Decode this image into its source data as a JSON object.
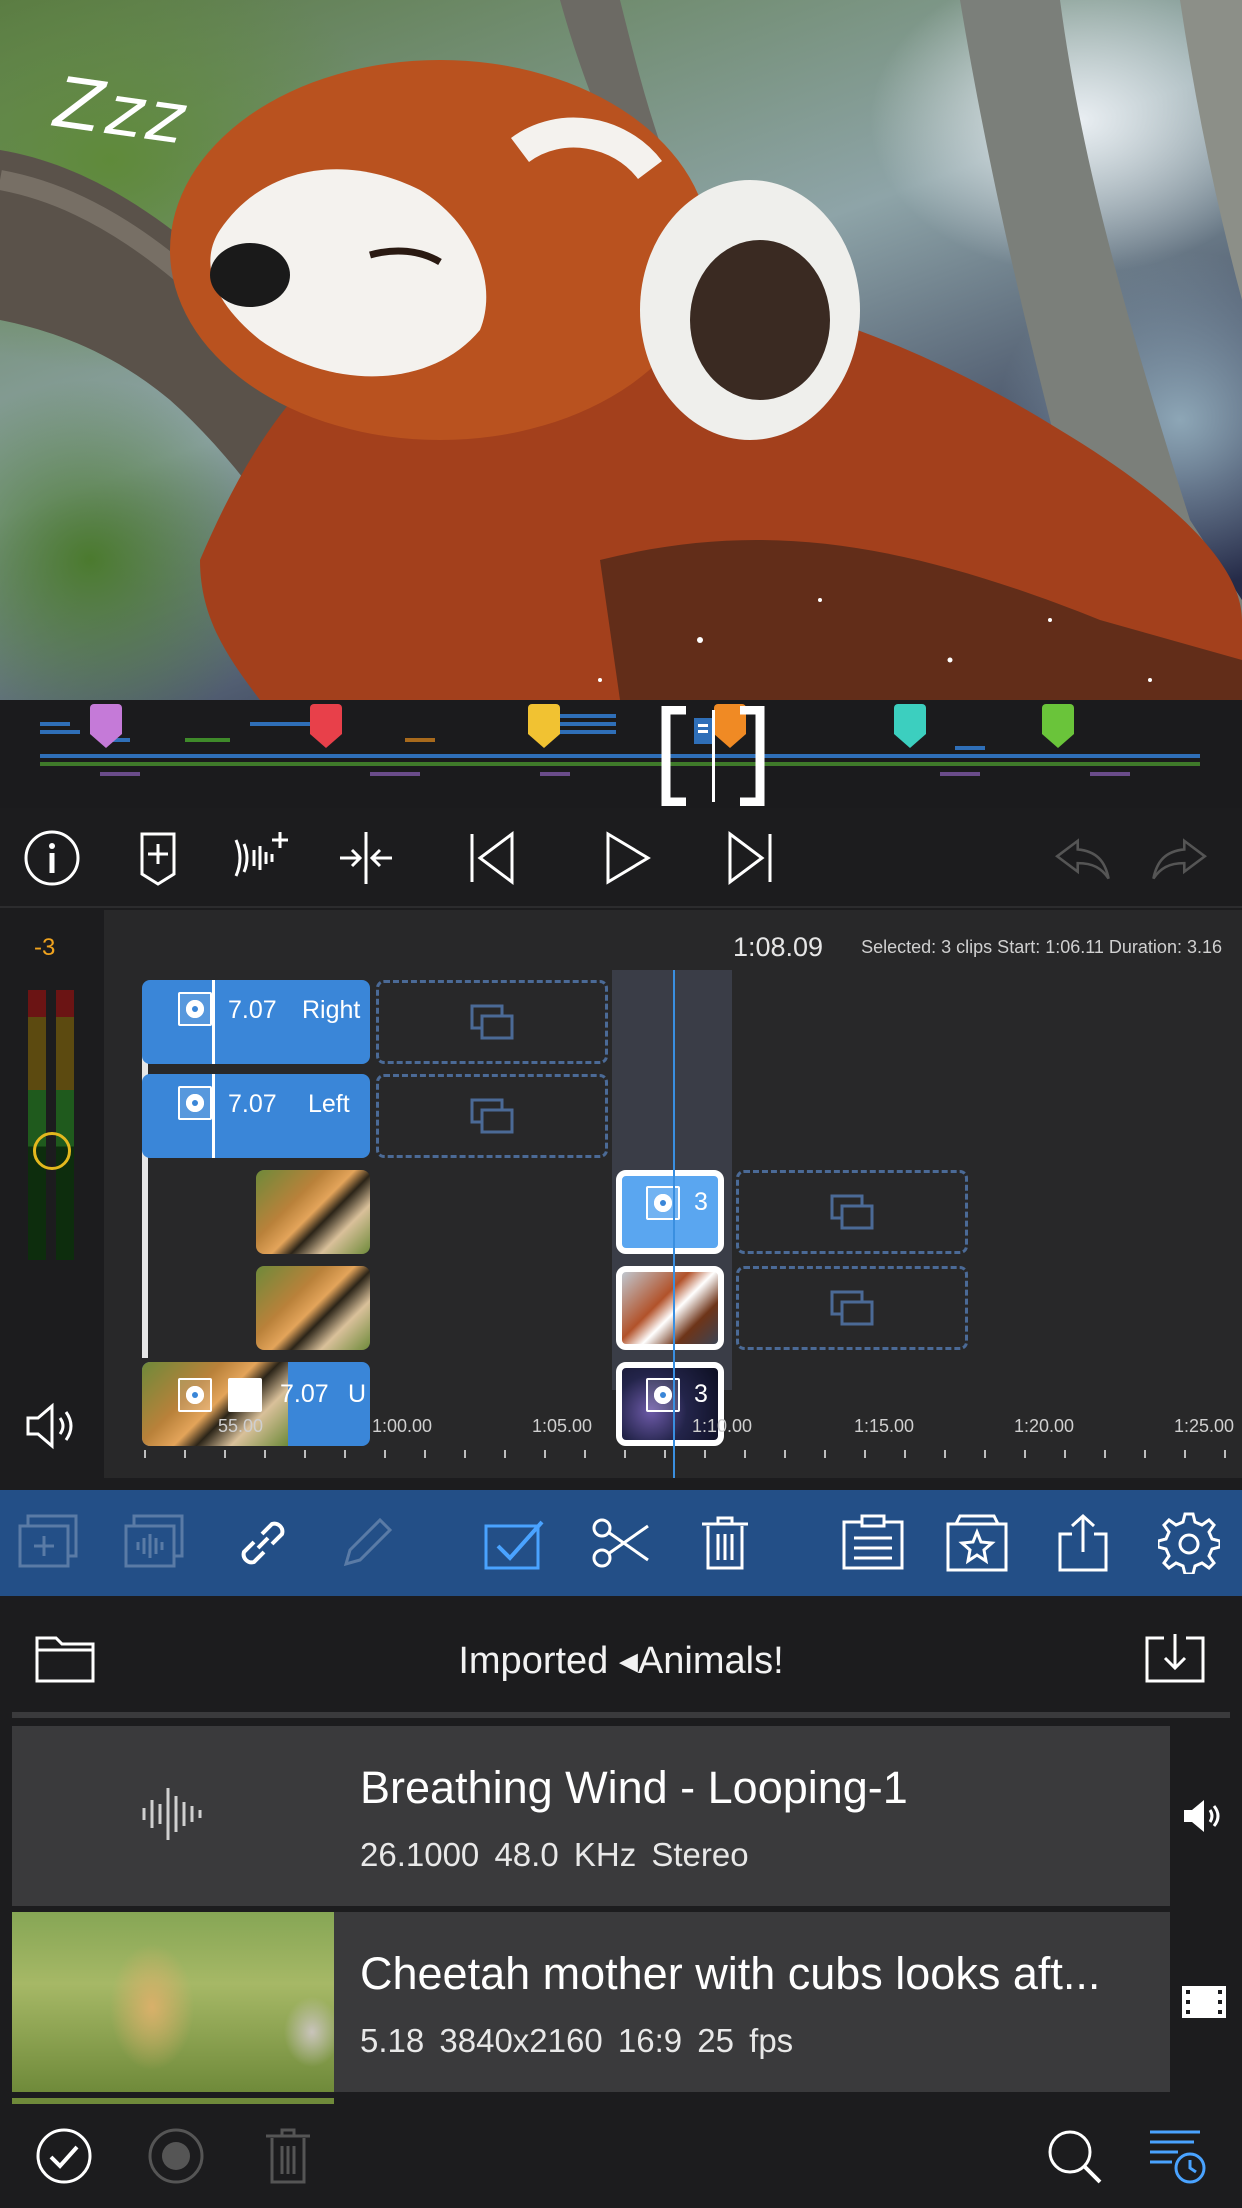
{
  "preview": {
    "overlay_text": "Zzz"
  },
  "overview": {
    "markers": [
      {
        "color": "#c57ad8"
      },
      {
        "color": "#e8404a"
      },
      {
        "color": "#f1c232"
      },
      {
        "color": "#f08a24"
      },
      {
        "color": "#3ccfbf"
      },
      {
        "color": "#6ac43a"
      }
    ]
  },
  "toolbar_top": {
    "icons": [
      "info-icon",
      "add-marker-icon",
      "voiceover-icon",
      "split-icon",
      "skip-start-icon",
      "play-icon",
      "skip-end-icon",
      "undo-icon",
      "redo-icon"
    ]
  },
  "timeline": {
    "meter_value": "-3",
    "current_time": "1:08.09",
    "selection_info": "Selected: 3 clips Start: 1:06.11 Duration: 3.16",
    "clips": [
      {
        "track": 1,
        "duration": "7.07",
        "name": "Right"
      },
      {
        "track": 2,
        "duration": "7.07",
        "name": "Left"
      },
      {
        "track": 5,
        "duration": "7.07",
        "name": "U"
      },
      {
        "track": 3,
        "duration": "3",
        "name": ""
      },
      {
        "track": 5,
        "duration": "3",
        "name": ""
      }
    ],
    "ruler_labels": [
      "55.00",
      "1:00.00",
      "1:05.00",
      "1:10.00",
      "1:15.00",
      "1:20.00",
      "1:25.00"
    ]
  },
  "toolbar_edit": {
    "icons": [
      "add-track-icon",
      "add-audio-track-icon",
      "link-icon",
      "pencil-icon",
      "select-icon",
      "scissors-icon",
      "trash-icon",
      "clipboard-icon",
      "favorites-icon",
      "share-icon",
      "settings-icon"
    ]
  },
  "browser": {
    "path": "Imported ◂Animals!",
    "items": [
      {
        "title": "Breathing Wind - Looping-1",
        "meta": "26.1000  48.0 KHz  Stereo",
        "type_icon": "speaker-icon"
      },
      {
        "title": "Cheetah mother with cubs looks aft...",
        "meta": "5.18  3840x2160  16:9  25 fps",
        "type_icon": "film-icon"
      }
    ]
  },
  "bottom_bar": {
    "icons": [
      "checkmark-icon",
      "record-icon",
      "trash-icon",
      "search-icon",
      "history-icon"
    ]
  }
}
